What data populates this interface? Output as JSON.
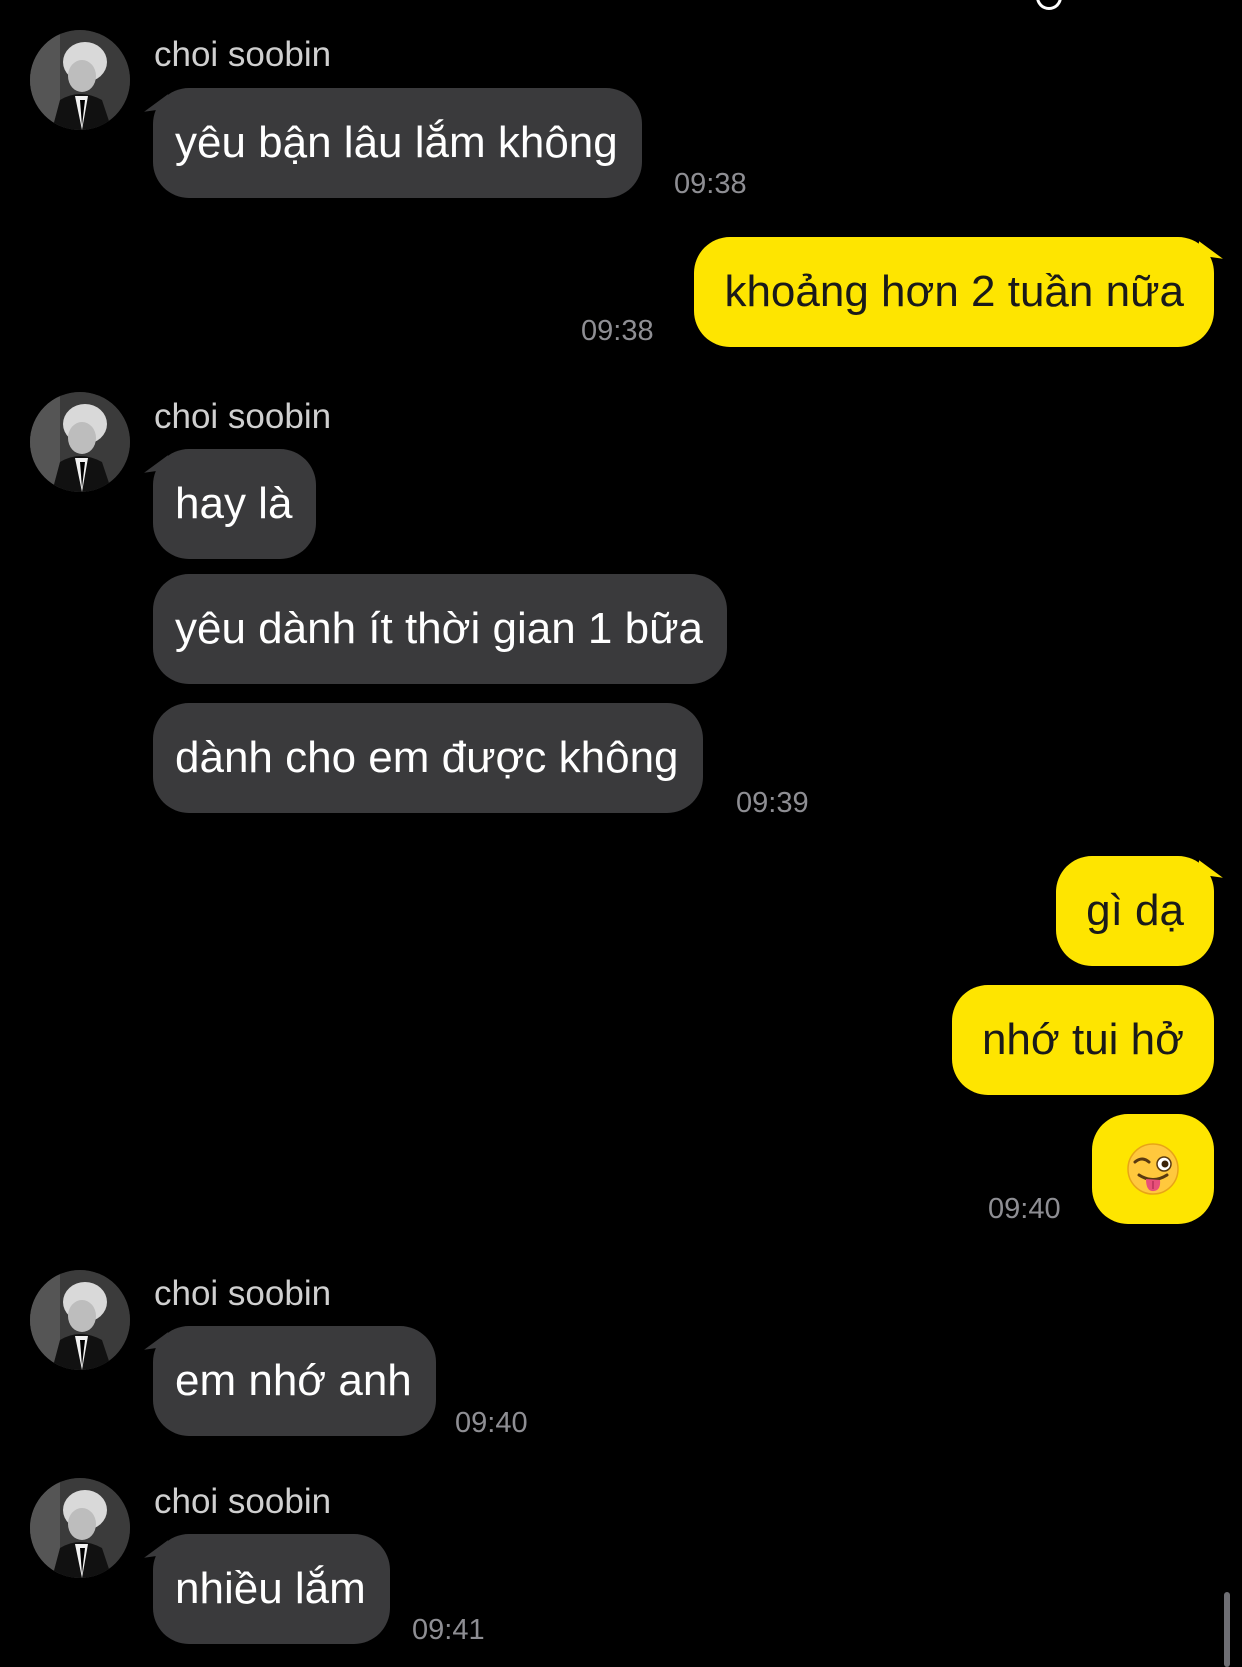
{
  "contact": {
    "name": "choi soobin"
  },
  "messages": [
    {
      "id": "m1",
      "from": "them",
      "text": "yêu bận lâu lắm không",
      "time": "09:38"
    },
    {
      "id": "m2",
      "from": "me",
      "text": "khoảng hơn 2 tuần nữa",
      "time": "09:38"
    },
    {
      "id": "m3",
      "from": "them",
      "text": "hay là"
    },
    {
      "id": "m4",
      "from": "them",
      "text": "yêu dành ít thời gian 1 bữa"
    },
    {
      "id": "m5",
      "from": "them",
      "text": "dành cho em được không",
      "time": "09:39"
    },
    {
      "id": "m6",
      "from": "me",
      "text": "gì dạ"
    },
    {
      "id": "m7",
      "from": "me",
      "text": "nhớ tui hở"
    },
    {
      "id": "m8",
      "from": "me",
      "emoji": "winking-face-with-tongue",
      "time": "09:40"
    },
    {
      "id": "m9",
      "from": "them",
      "text": "em nhớ anh",
      "time": "09:40"
    },
    {
      "id": "m10",
      "from": "them",
      "text": "nhiều lắm",
      "time": "09:41"
    }
  ],
  "colors": {
    "background": "#000000",
    "incoming_bubble": "#3a3a3c",
    "outgoing_bubble": "#fee500",
    "timestamp": "#8e8e93"
  }
}
